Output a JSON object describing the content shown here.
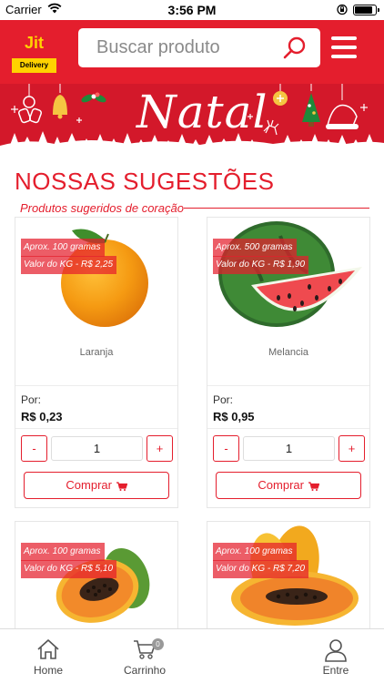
{
  "status_bar": {
    "carrier": "Carrier",
    "time": "3:56 PM"
  },
  "header": {
    "logo_text": "Jit",
    "logo_subtext": "Delivery",
    "search_placeholder": "Buscar produto",
    "brand_color": "#e41e2d",
    "logo_color": "#ffd200"
  },
  "banner": {
    "title": "Natal"
  },
  "section": {
    "title": "NOSSAS SUGESTÕES",
    "subtitle": "Produtos sugeridos de coração"
  },
  "products": [
    {
      "name": "Laranja",
      "tag_weight": "Aprox. 100 gramas",
      "tag_kg": "Valor do KG - R$ 2,25",
      "price_label": "Por:",
      "price": "R$ 0,23",
      "quantity": "1",
      "minus": "-",
      "plus": "+",
      "buy_label": "Comprar"
    },
    {
      "name": "Melancia",
      "tag_weight": "Aprox. 500 gramas",
      "tag_kg": "Valor do KG - R$ 1,90",
      "price_label": "Por:",
      "price": "R$ 0,95",
      "quantity": "1",
      "minus": "-",
      "plus": "+",
      "buy_label": "Comprar"
    },
    {
      "name": "",
      "tag_weight": "Aprox. 100 gramas",
      "tag_kg": "Valor do KG - R$ 5,10"
    },
    {
      "name": "",
      "tag_weight": "Aprox. 100 gramas",
      "tag_kg": "Valor do KG - R$ 7,20"
    }
  ],
  "bottom_nav": {
    "home": "Home",
    "cart": "Carrinho",
    "cart_count": "0",
    "login": "Entre"
  }
}
